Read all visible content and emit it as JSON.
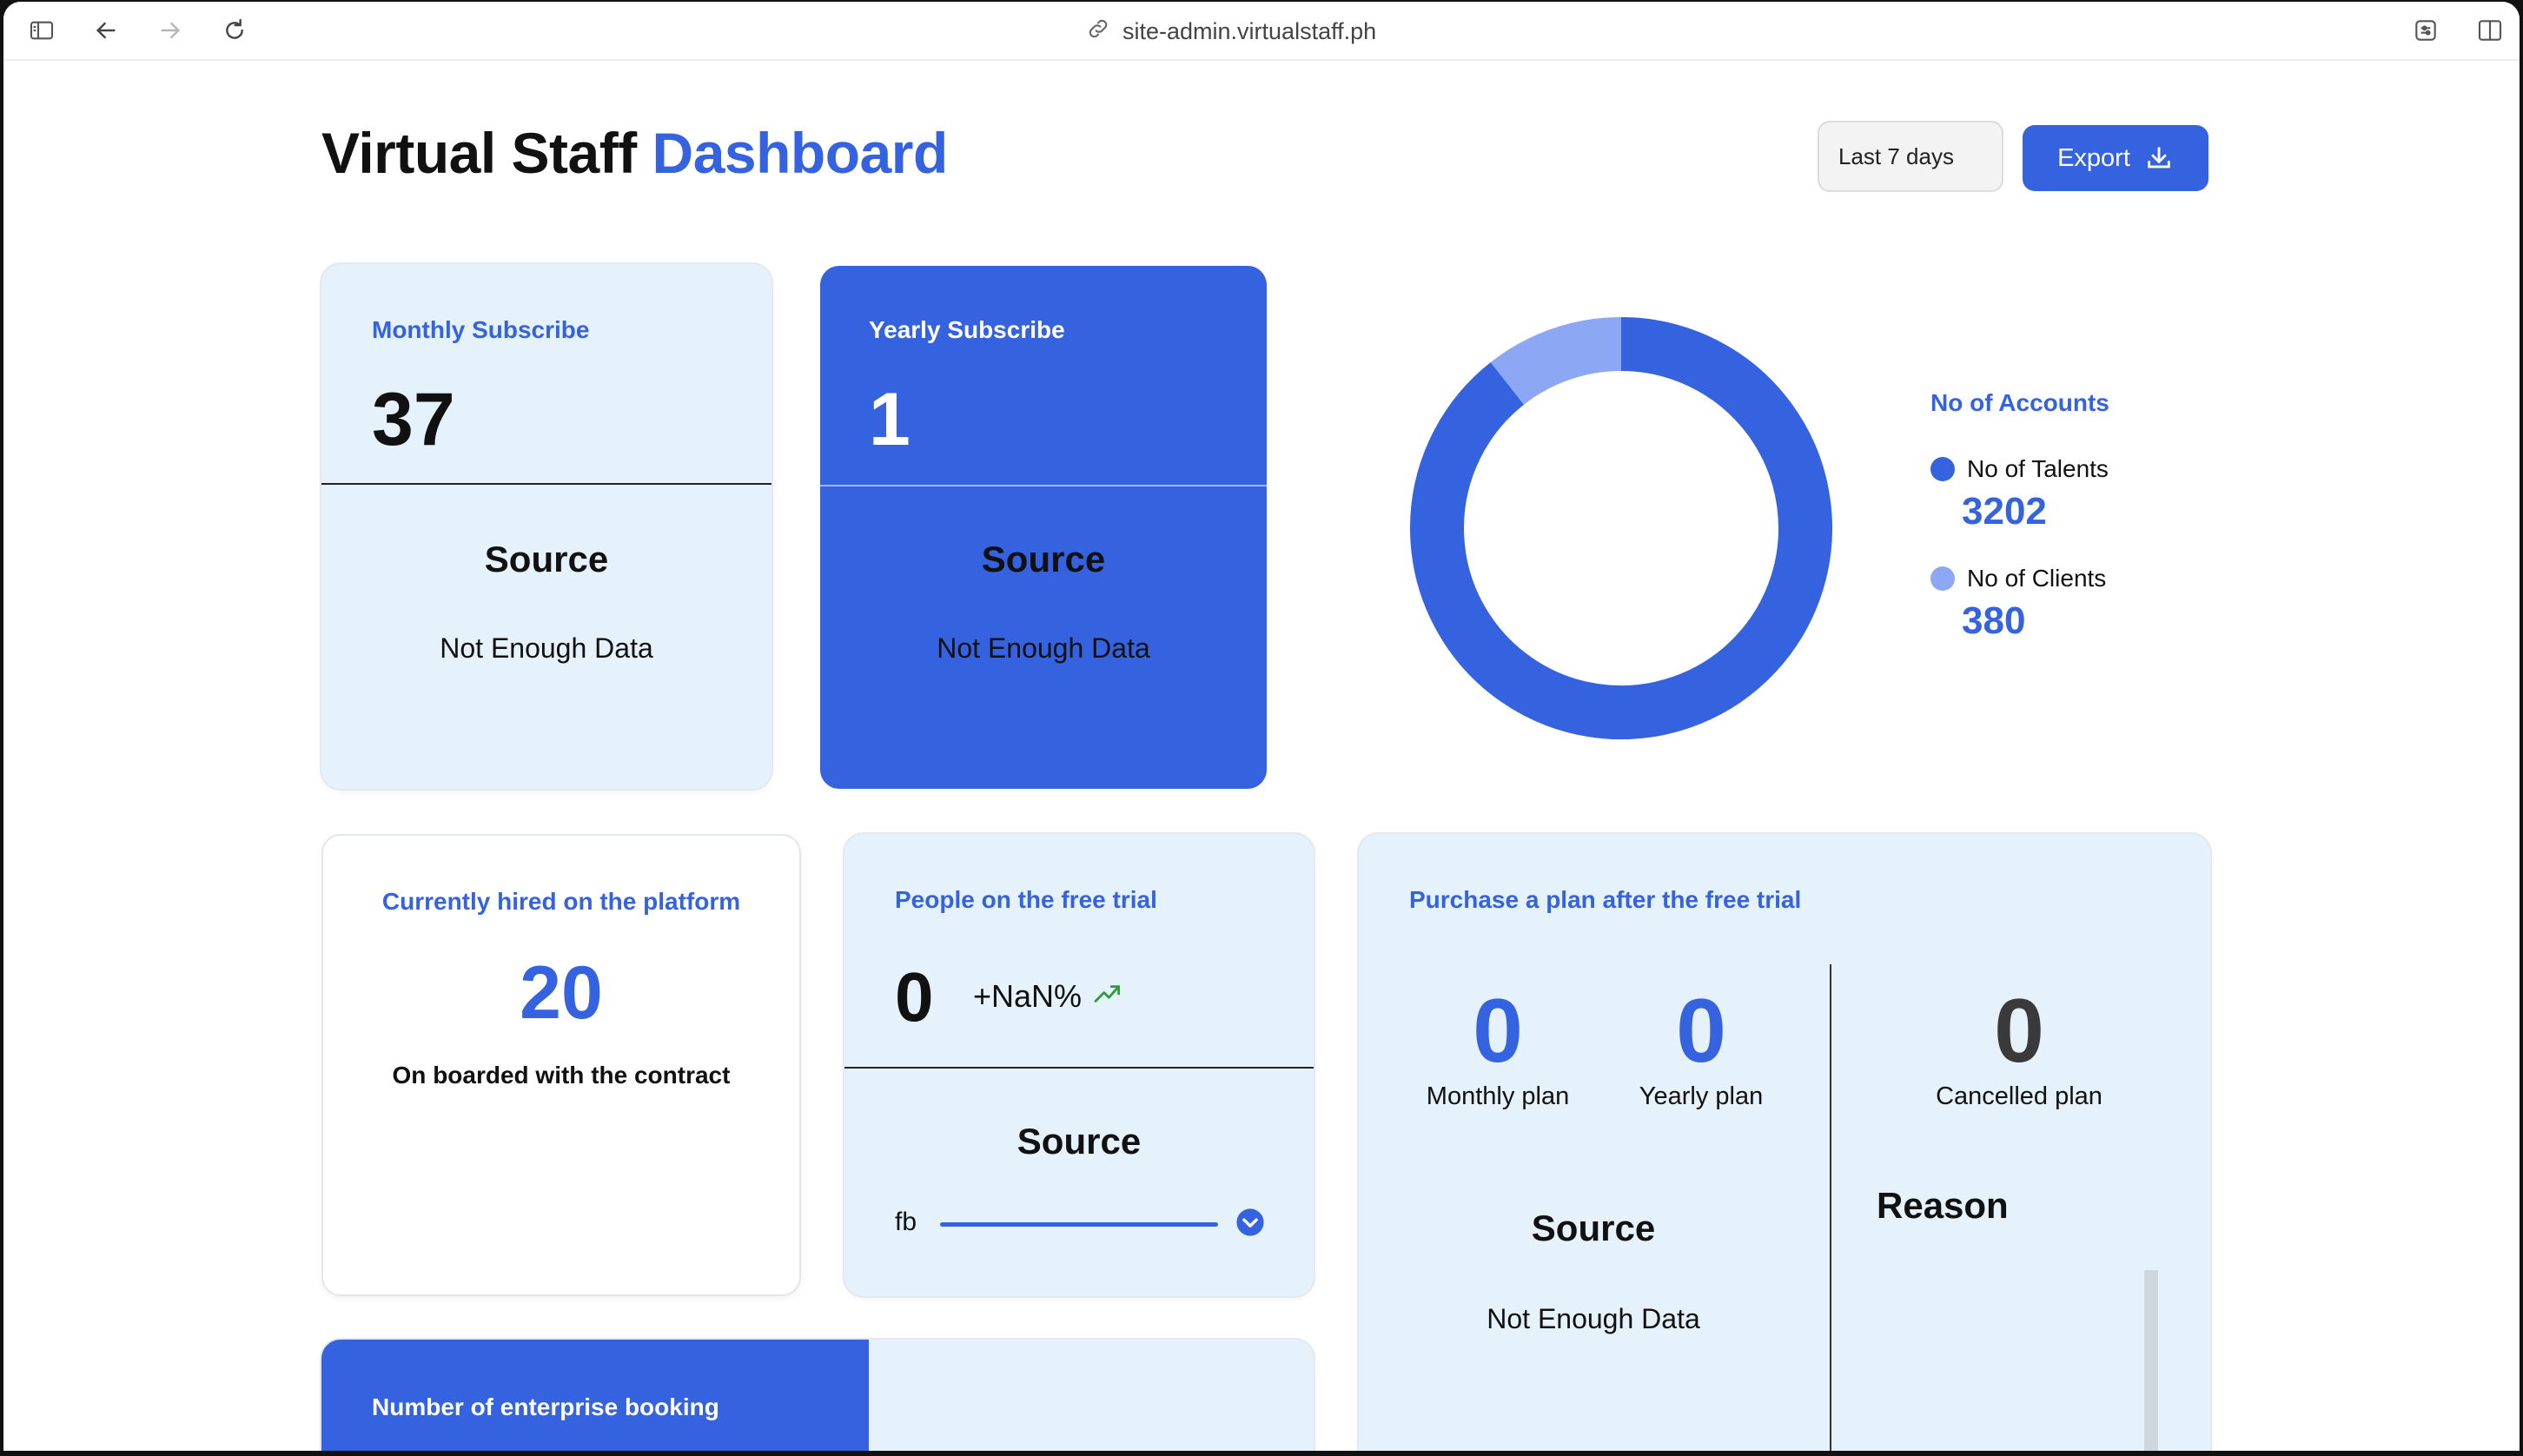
{
  "browser": {
    "url": "site-admin.virtualstaff.ph",
    "icons": [
      "sidebar-icon",
      "back-arrow-icon",
      "forward-arrow-icon",
      "reload-icon",
      "link-icon",
      "extensions-icon",
      "split-view-icon"
    ]
  },
  "header": {
    "title_main": "Virtual Staff",
    "title_accent": "Dashboard",
    "range_label": "Last 7 days",
    "export_label": "Export"
  },
  "monthly": {
    "label": "Monthly Subscribe",
    "value": "37",
    "source_heading": "Source",
    "source_text": "Not Enough Data"
  },
  "yearly": {
    "label": "Yearly Subscribe",
    "value": "1",
    "source_heading": "Source",
    "source_text": "Not Enough Data"
  },
  "accounts": {
    "title": "No of Accounts",
    "talents_label": "No of Talents",
    "talents_value": "3202",
    "clients_label": "No of Clients",
    "clients_value": "380"
  },
  "chart_data": {
    "type": "pie",
    "donut": true,
    "categories": [
      "No of Talents",
      "No of Clients"
    ],
    "values": [
      3202,
      380
    ],
    "colors": [
      "#3563e0",
      "#8ca8f4"
    ],
    "title": "No of Accounts"
  },
  "hired": {
    "label": "Currently hired on the platform",
    "value": "20",
    "subtext": "On boarded with the contract"
  },
  "trial": {
    "label": "People on the free trial",
    "value": "0",
    "change": "+NaN%",
    "source_heading": "Source",
    "source_item": "fb"
  },
  "purchase": {
    "label": "Purchase a plan after the free trial",
    "monthly_value": "0",
    "monthly_label": "Monthly plan",
    "yearly_value": "0",
    "yearly_label": "Yearly plan",
    "cancelled_value": "0",
    "cancelled_label": "Cancelled plan",
    "source_heading": "Source",
    "source_text": "Not Enough Data",
    "reason_heading": "Reason"
  },
  "enterprise": {
    "label": "Number of enterprise booking"
  },
  "colors": {
    "accent": "#3563e0",
    "accent_light": "#8ca8f4",
    "card_light": "#e5f1fb",
    "trend_up": "#2e9a3e"
  }
}
